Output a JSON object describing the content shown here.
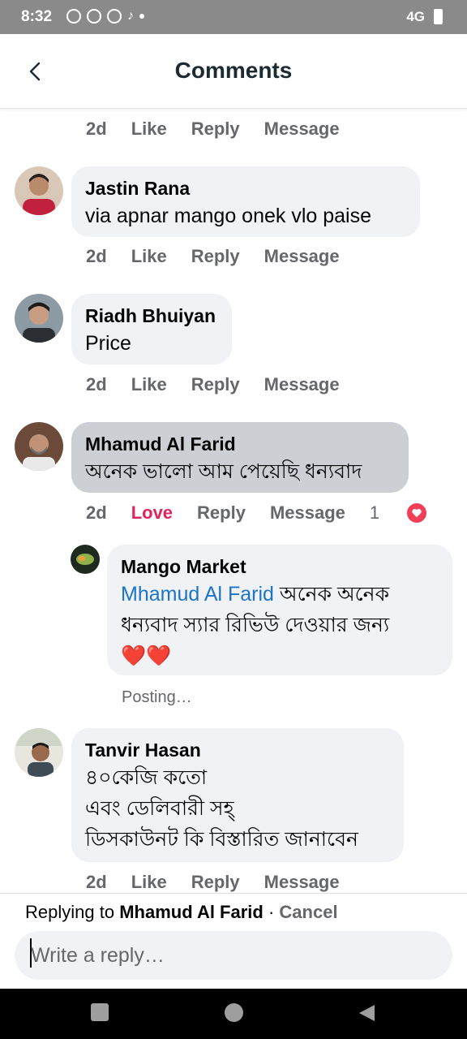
{
  "status_bar": {
    "time": "8:32",
    "network": "4G"
  },
  "header": {
    "title": "Comments"
  },
  "comments": [
    {
      "age": "2d",
      "like": "Like",
      "reply": "Reply",
      "message": "Message"
    },
    {
      "name": "Jastin Rana",
      "text": "via apnar mango onek vlo paise",
      "age": "2d",
      "like": "Like",
      "reply": "Reply",
      "message": "Message"
    },
    {
      "name": "Riadh Bhuiyan",
      "text": "Price",
      "age": "2d",
      "like": "Like",
      "reply": "Reply",
      "message": "Message"
    },
    {
      "name": "Mhamud Al Farid",
      "text": "অনেক ভালো আম পেয়েছি ধন্যবাদ",
      "age": "2d",
      "like": "Love",
      "reply": "Reply",
      "message": "Message",
      "reaction_count": "1"
    },
    {
      "name": "Tanvir Hasan",
      "lines": [
        "৪০কেজি কতো",
        "এবং ডেলিবারী সহ্",
        "ডিসকাউনট কি বিস্তারিত জানাবেন"
      ],
      "age": "2d",
      "like": "Like",
      "reply": "Reply",
      "message": "Message"
    }
  ],
  "reply": {
    "name": "Mango Market",
    "mention": "Mhamud Al Farid",
    "text_line1": " অনেক অনেক",
    "text_line2": "ধন্যবাদ স্যার রিভিউ দেওয়ার জন্য",
    "emoji": "❤️❤️",
    "status": "Posting…"
  },
  "reply_bar": {
    "prefix": "Replying to",
    "target": "Mhamud Al Farid",
    "separator": " · ",
    "cancel": "Cancel",
    "placeholder": "Write a reply…"
  },
  "colors": {
    "love": "#e0245e",
    "mention": "#1b74c9",
    "bubble": "#f0f2f5",
    "bubble_highlight": "#ccd0d5"
  }
}
